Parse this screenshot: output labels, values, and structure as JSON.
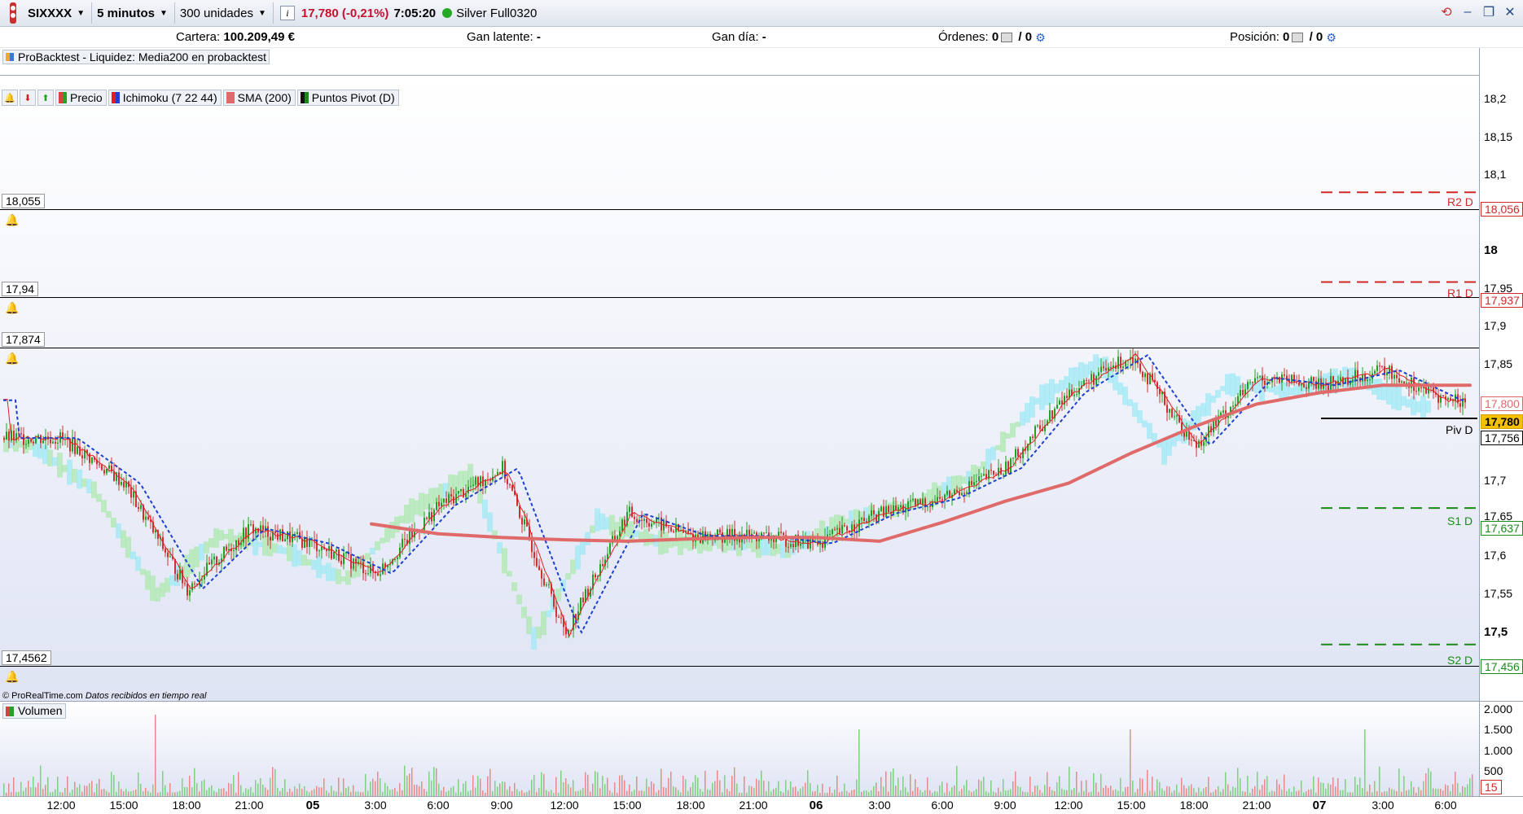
{
  "toolbar": {
    "symbol": "SIXXXX",
    "timeframe": "5 minutos",
    "units": "300 unidades",
    "info_icon": "i",
    "last_price": "17,780 (-0,21%)",
    "time": "7:05:20",
    "connection": "Silver Full0320"
  },
  "account": {
    "cartera_label": "Cartera:",
    "cartera_value": "100.209,49 €",
    "gan_latente_label": "Gan latente:",
    "gan_latente_value": "-",
    "gan_dia_label": "Gan día:",
    "gan_dia_value": "-",
    "ordenes_label": "Órdenes:",
    "ordenes_a": "0",
    "ordenes_b": "/ 0",
    "posicion_label": "Posición:",
    "posicion_a": "0",
    "posicion_b": "/ 0"
  },
  "backtest_label": "ProBacktest - Liquidez: Media200 en probacktest",
  "legend": {
    "precio": "Precio",
    "ichimoku": "Ichimoku (7 22 44)",
    "sma": "SMA (200)",
    "pivot": "Puntos Pivot (D)"
  },
  "alert_lines": {
    "l1": "18,055",
    "l2": "17,94",
    "l3": "17,874",
    "l4": "17,4562"
  },
  "pivots": {
    "r2": "R2 D",
    "r1": "R1 D",
    "piv": "Piv D",
    "s1": "S1 D",
    "s2": "S2 D"
  },
  "price_axis": {
    "ticks": [
      "18,2",
      "18,15",
      "18,1",
      "18",
      "17,95",
      "17,9",
      "17,85",
      "17,7",
      "17,65",
      "17,6",
      "17,55",
      "17,5"
    ],
    "box_r2": "18,056",
    "box_r1": "17,937",
    "box_sma": "17,800",
    "box_last": "17,780",
    "box_piv": "17,756",
    "box_s1": "17,637",
    "box_s2": "17,456"
  },
  "footer": {
    "source": "© ProRealTime.com",
    "realtime": "Datos recibidos en tiempo real"
  },
  "volume": {
    "label": "Volumen",
    "ticks": [
      "2.000",
      "1.500",
      "1.000",
      "500"
    ],
    "current": "15"
  },
  "time_axis": {
    "labels": [
      "12:00",
      "15:00",
      "18:00",
      "21:00",
      "05",
      "3:00",
      "6:00",
      "9:00",
      "12:00",
      "15:00",
      "18:00",
      "21:00",
      "06",
      "3:00",
      "6:00",
      "9:00",
      "12:00",
      "15:00",
      "18:00",
      "21:00",
      "07",
      "3:00",
      "6:00"
    ]
  },
  "chart_data": {
    "type": "line",
    "title": "",
    "x": [
      "12:00",
      "15:00",
      "18:00",
      "21:00",
      "05",
      "3:00",
      "6:00",
      "9:00",
      "12:00",
      "15:00",
      "18:00",
      "21:00",
      "06",
      "3:00",
      "6:00",
      "9:00",
      "12:00",
      "15:00",
      "18:00",
      "21:00",
      "07",
      "3:00",
      "6:00"
    ],
    "series": [
      {
        "name": "Precio",
        "values": [
          17.73,
          17.67,
          17.53,
          17.61,
          17.59,
          17.55,
          17.64,
          17.69,
          17.47,
          17.63,
          17.6,
          17.6,
          17.59,
          17.63,
          17.65,
          17.69,
          17.79,
          17.84,
          17.72,
          17.81,
          17.8,
          17.82,
          17.78
        ]
      },
      {
        "name": "SMA (200)",
        "values": [
          null,
          null,
          null,
          null,
          null,
          17.616,
          17.603,
          17.598,
          17.595,
          17.593,
          17.596,
          17.598,
          17.598,
          17.593,
          17.618,
          17.646,
          17.67,
          17.71,
          17.745,
          17.775,
          17.79,
          17.8,
          17.8
        ]
      }
    ],
    "pivot_levels": {
      "R2 D": 18.056,
      "R1 D": 17.937,
      "Piv D": 17.756,
      "S1 D": 17.637,
      "S2 D": 17.456
    },
    "ylim": [
      17.4,
      18.2
    ],
    "volume_peaks": [
      1900,
      1550,
      1550,
      1550
    ]
  },
  "colors": {
    "up": "#23a023",
    "down": "#d03030",
    "sma": "#e06a6a",
    "tenkan": "#e02020",
    "kijun": "#1f3fd0",
    "kumo_bull": "#aee8b0",
    "kumo_bear": "#9fe8f4",
    "r_level": "#d02828",
    "s_level": "#1a8a1a"
  }
}
